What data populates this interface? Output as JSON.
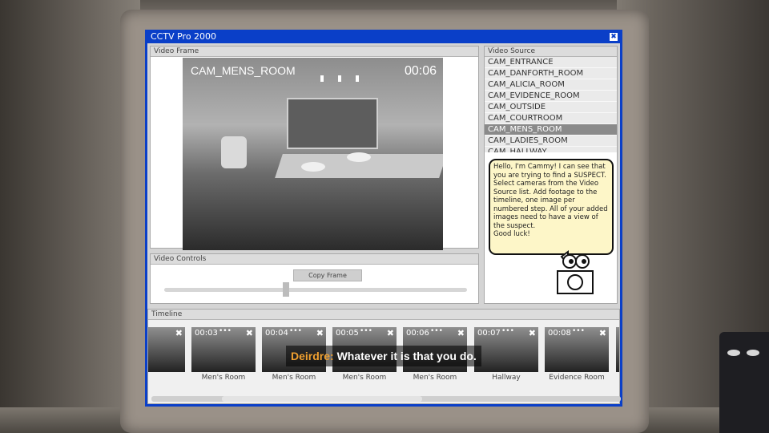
{
  "window": {
    "title": "CCTV Pro 2000",
    "close_glyph": "✖"
  },
  "video_frame": {
    "panel_label": "Video Frame",
    "camera_label": "CAM_MENS_ROOM",
    "time": "00:06"
  },
  "video_source": {
    "panel_label": "Video Source",
    "selected_index": 6,
    "items": [
      "CAM_ENTRANCE",
      "CAM_DANFORTH_ROOM",
      "CAM_ALICIA_ROOM",
      "CAM_EVIDENCE_ROOM",
      "CAM_OUTSIDE",
      "CAM_COURTROOM",
      "CAM_MENS_ROOM",
      "CAM_LADIES_ROOM",
      "CAM_HALLWAY"
    ]
  },
  "assistant": {
    "message": "Hello, I'm Cammy! I can see that you are trying to find a SUSPECT.\nSelect cameras from the Video Source list. Add footage to the timeline, one image per numbered step. All of your added images need to have a view of the suspect.\nGood luck!",
    "icon": "camera-mascot-icon"
  },
  "video_controls": {
    "panel_label": "Video Controls",
    "copy_button": "Copy Frame",
    "slider_position": 0.4
  },
  "timeline": {
    "panel_label": "Timeline",
    "items": [
      {
        "num": "",
        "label": ""
      },
      {
        "num": "00:03",
        "label": "Men's Room"
      },
      {
        "num": "00:04",
        "label": "Men's Room"
      },
      {
        "num": "00:05",
        "label": "Men's Room"
      },
      {
        "num": "00:06",
        "label": "Men's Room"
      },
      {
        "num": "00:07",
        "label": "Hallway"
      },
      {
        "num": "00:08",
        "label": "Evidence Room"
      },
      {
        "num": "",
        "label": "E"
      }
    ]
  },
  "subtitle": {
    "speaker": "Deirdre:",
    "line": "Whatever it is that you do."
  },
  "colors": {
    "titlebar": "#0a3fc8",
    "bubble": "#fdf6c8",
    "speaker": "#f0a030"
  }
}
